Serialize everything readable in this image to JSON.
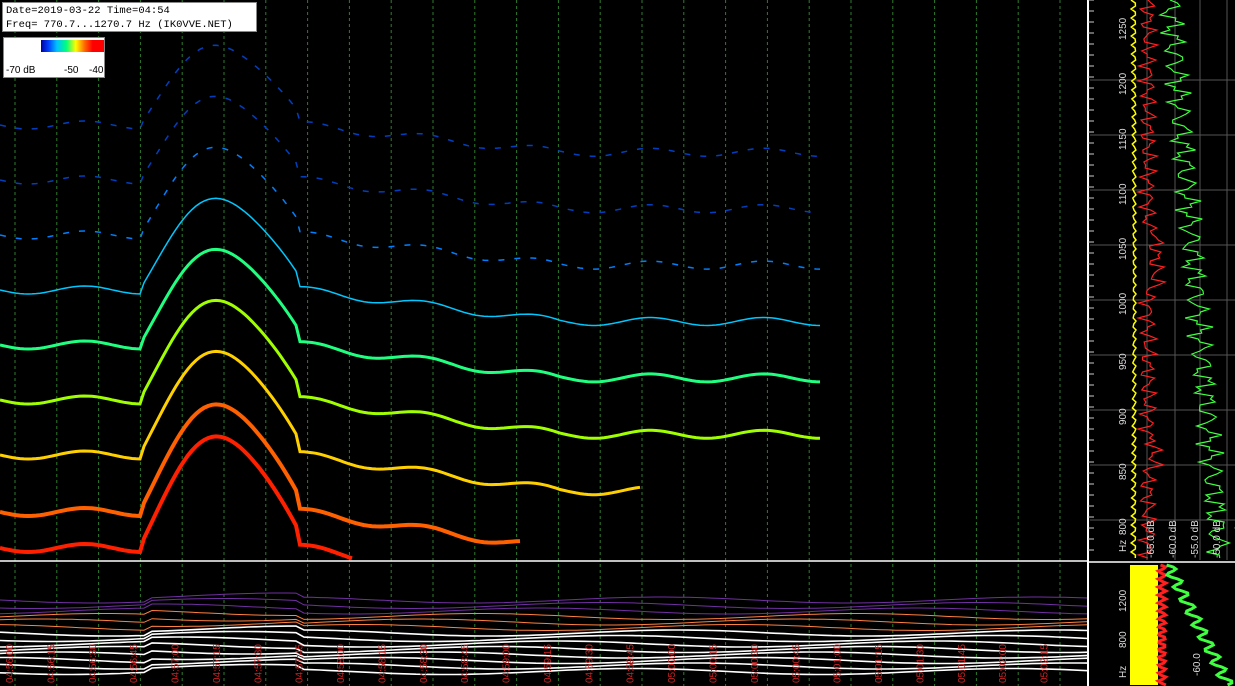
{
  "header": {
    "date_line": "Date=2019-03-22 Time=04:54",
    "freq_line": "Freq= 770.7...1270.7 Hz (IK0VVE.NET)"
  },
  "color_scale": {
    "min_label": "-70 dB",
    "mid_label": "-50",
    "max_label": "-40"
  },
  "freq_axis": {
    "unit": "Hz",
    "ticks": [
      "1250",
      "1200",
      "1150",
      "1100",
      "1050",
      "1000",
      "950",
      "900",
      "850",
      "800"
    ]
  },
  "spectrum_db_labels": [
    "-65.0 dB",
    "-60.0 dB",
    "-55.0 dB",
    "-50.0 dB",
    "-45.0 dB"
  ],
  "lower_axis": {
    "ticks": [
      "1200",
      "800",
      "Hz"
    ],
    "db_label": "-60.0"
  },
  "time_labels": [
    "04:56:00",
    "04:56:15",
    "04:56:30",
    "04:56:45",
    "04:57:00",
    "04:57:15",
    "04:57:30",
    "04:57:45",
    "04:58:00",
    "04:58:15",
    "04:58:30",
    "04:58:45",
    "04:59:00",
    "04:59:15",
    "04:59:30",
    "04:59:45",
    "05:00:00",
    "05:00:15",
    "05:00:30",
    "05:00:45",
    "05:01:00",
    "05:01:15",
    "05:01:30",
    "05:01:45",
    "05:02:00",
    "05:02:15",
    "05:02:30",
    "05:02:45",
    "05:03:00",
    "05:03:15",
    "05:03:30",
    "05:03:45"
  ],
  "colors": {
    "grid": "#2e7d2e",
    "green_trace": "#40ff40",
    "red_trace": "#ff2020",
    "yellow_band": "#ffff00",
    "time_text": "#cc2222"
  }
}
